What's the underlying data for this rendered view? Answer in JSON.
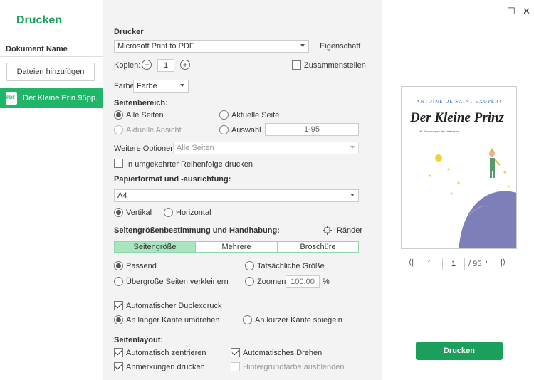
{
  "sidebar": {
    "title": "Drucken",
    "doc_header": "Dokument Name",
    "add_button": "Dateien hinzufügen",
    "files": [
      {
        "icon_label": "PDF",
        "name": "Der Kleine Prin..",
        "pages": "95pp."
      }
    ]
  },
  "printer": {
    "section": "Drucker",
    "selected": "Microsoft Print to PDF",
    "properties": "Eigenschaft",
    "copies_label": "Kopien:",
    "copies": "1",
    "collate": "Zusammenstellen",
    "color_label": "Farbe",
    "color_value": "Farbe"
  },
  "range": {
    "section": "Seitenbereich:",
    "all": "Alle Seiten",
    "current": "Aktuelle Seite",
    "current_view": "Aktuelle Ansicht",
    "selection": "Auswahl",
    "selection_value": "1-95",
    "more_label": "Weitere Optionen:",
    "more_value": "Alle Seiten",
    "reverse": "In umgekehrter Reihenfolge drucken"
  },
  "paper": {
    "section": "Papierformat und -ausrichtung:",
    "size": "A4",
    "portrait": "Vertikal",
    "landscape": "Horizontal"
  },
  "sizing": {
    "section": "Seitengrößenbestimmung und Handhabung:",
    "margins": "Ränder",
    "tabs": [
      "Seitengröße",
      "Mehrere",
      "Broschüre"
    ],
    "fit": "Passend",
    "actual": "Tatsächliche Größe",
    "shrink": "Übergroße Seiten verkleinern",
    "zoom": "Zoomen",
    "zoom_value": "100.00",
    "zoom_unit": "%",
    "duplex": "Automatischer Duplexdruck",
    "long_edge": "An langer Kante umdrehen",
    "short_edge": "An kurzer Kante spiegeln"
  },
  "layout": {
    "section": "Seitenlayout:",
    "center": "Automatisch zentrieren",
    "rotate": "Automatisches Drehen",
    "annotations": "Anmerkungen drucken",
    "hide_bg": "Hintergrundfarbe ausblenden"
  },
  "preview": {
    "author": "ANTOINE DE SAINT-EXUPÉRY",
    "title": "Der Kleine Prinz",
    "subtitle": "Mit Zeichnungen des Verfassers",
    "page": "1",
    "total": "/ 95",
    "print_button": "Drucken"
  },
  "colors": {
    "accent": "#1aa05a",
    "panel_bg": "#f3f3f3",
    "planet": "#7c7fb8"
  }
}
